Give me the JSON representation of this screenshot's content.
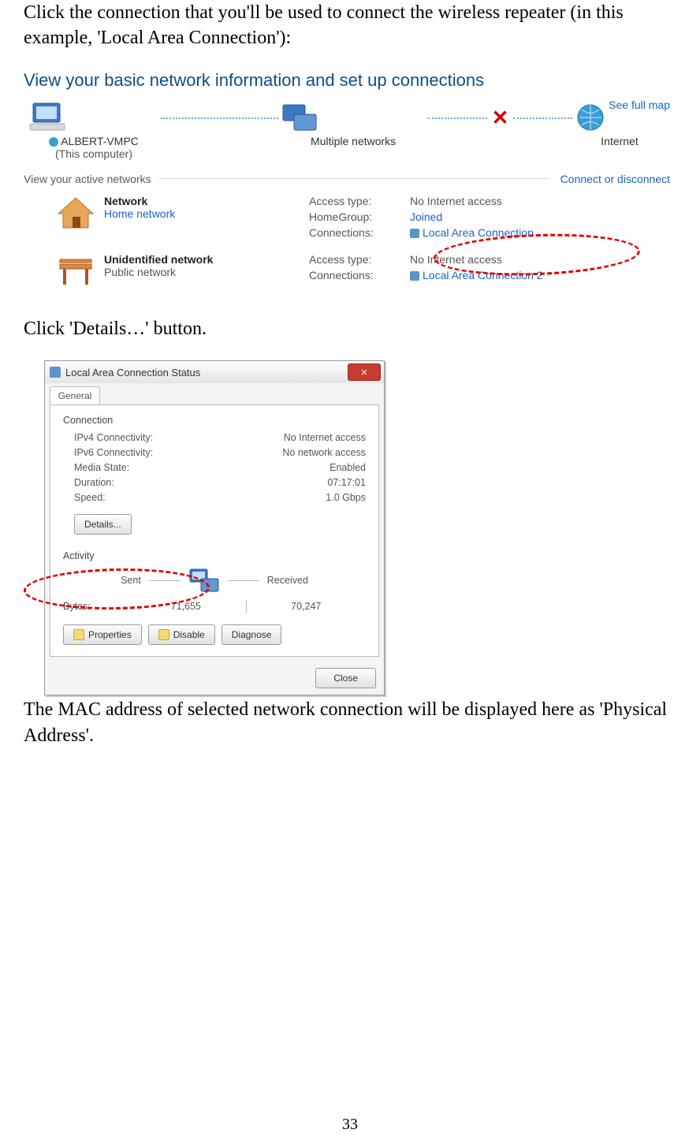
{
  "doc": {
    "instruction1": "Click the connection that you'll be used to connect the wireless repeater (in this example, 'Local Area Connection'):",
    "instruction2": "Click 'Details…' button.",
    "instruction3": "The MAC address of selected network connection will be displayed here as 'Physical Address'.",
    "pagenum": "33"
  },
  "shot1": {
    "heading": "View your basic network information and set up connections",
    "see_full_map": "See full map",
    "map_pc": "ALBERT-VMPC",
    "map_pc_sub": "(This computer)",
    "map_mid": "Multiple networks",
    "map_inet": "Internet",
    "section_active": "View your active networks",
    "connect_link": "Connect or disconnect",
    "net1_name": "Network",
    "net1_kind": "Home network",
    "net2_name": "Unidentified network",
    "net2_kind": "Public network",
    "k_access": "Access type:",
    "k_homegroup": "HomeGroup:",
    "k_connections": "Connections:",
    "v_noinet": "No Internet access",
    "v_joined": "Joined",
    "v_lac1": "Local Area Connection",
    "v_lac2": "Local Area Connection 2"
  },
  "shot2": {
    "title": "Local Area Connection Status",
    "tab": "General",
    "section_conn": "Connection",
    "k_ipv4": "IPv4 Connectivity:",
    "k_ipv6": "IPv6 Connectivity:",
    "k_media": "Media State:",
    "k_duration": "Duration:",
    "k_speed": "Speed:",
    "v_ipv4": "No Internet access",
    "v_ipv6": "No network access",
    "v_media": "Enabled",
    "v_duration": "07:17:01",
    "v_speed": "1.0 Gbps",
    "btn_details": "Details...",
    "section_activity": "Activity",
    "sent": "Sent",
    "recv": "Received",
    "bytes_label": "Bytes:",
    "bytes_sent": "71,655",
    "bytes_recv": "70,247",
    "btn_properties": "Properties",
    "btn_disable": "Disable",
    "btn_diagnose": "Diagnose",
    "btn_close": "Close"
  }
}
